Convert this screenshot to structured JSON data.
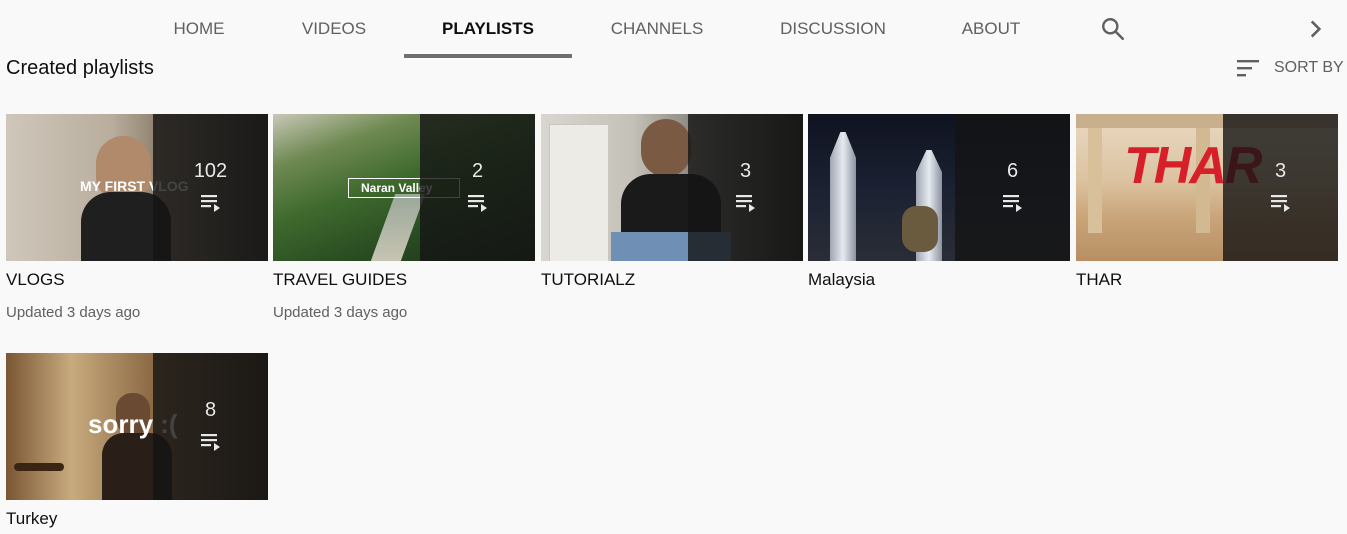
{
  "tabs": [
    {
      "label": "HOME"
    },
    {
      "label": "VIDEOS"
    },
    {
      "label": "PLAYLISTS"
    },
    {
      "label": "CHANNELS"
    },
    {
      "label": "DISCUSSION"
    },
    {
      "label": "ABOUT"
    }
  ],
  "active_tab": "PLAYLISTS",
  "section_title": "Created playlists",
  "sort_by_label": "SORT BY",
  "playlists": [
    {
      "title": "VLOGS",
      "count": "102",
      "updated": "Updated 3 days ago",
      "thumb_text": "MY FIRST VLOG"
    },
    {
      "title": "TRAVEL GUIDES",
      "count": "2",
      "updated": "Updated 3 days ago",
      "thumb_text": "Naran Valley"
    },
    {
      "title": "TUTORIALZ",
      "count": "3",
      "updated": ""
    },
    {
      "title": "Malaysia",
      "count": "6",
      "updated": ""
    },
    {
      "title": "THAR",
      "count": "3",
      "updated": "",
      "thumb_text": "THAR"
    },
    {
      "title": "Turkey",
      "count": "8",
      "updated": "",
      "thumb_text": "sorry :("
    }
  ],
  "icons": {
    "search": "search-icon",
    "next": "chevron-right-icon",
    "sort": "sort-icon",
    "playlist": "playlist-play-icon"
  },
  "colors": {
    "background": "#f9f9f9",
    "active_underline": "#6f6f6f",
    "muted_text": "#606060"
  }
}
